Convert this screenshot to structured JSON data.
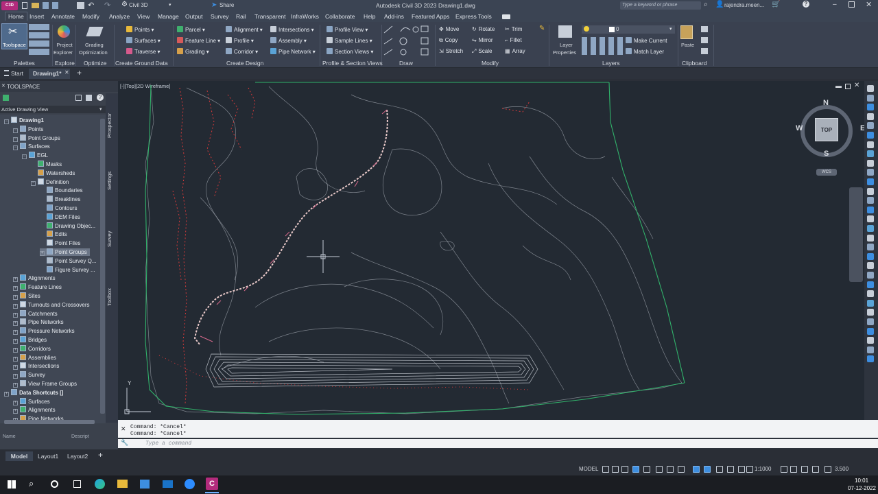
{
  "quick_access": {
    "app_badge": "C3D",
    "workspace": "Civil 3D",
    "share_label": "Share",
    "title": "Autodesk Civil 3D 2023",
    "document": "Drawing1.dwg",
    "search_placeholder": "Type a keyword or phrase",
    "user": "rajendra.meen..."
  },
  "ribbon_tabs": [
    "Home",
    "Insert",
    "Annotate",
    "Modify",
    "Analyze",
    "View",
    "Manage",
    "Output",
    "Survey",
    "Rail",
    "Transparent",
    "InfraWorks",
    "Collaborate",
    "Help",
    "Add-ins",
    "Featured Apps",
    "Express Tools"
  ],
  "ribbon": {
    "toolspace": "Toolspace",
    "project_explorer": [
      "Project",
      "Explorer"
    ],
    "grading_optimization": [
      "Grading",
      "Optimization"
    ],
    "ground": [
      "Points",
      "Surfaces",
      "Traverse"
    ],
    "ground2": [
      "Parcel",
      "Feature Line",
      "Grading"
    ],
    "design": [
      "Alignment",
      "Profile",
      "Corridor"
    ],
    "design2": [
      "Intersections",
      "Assembly",
      "Pipe Network"
    ],
    "profile": [
      "Profile View",
      "Sample Lines",
      "Section Views"
    ],
    "modify": [
      "Move",
      "Copy",
      "Stretch"
    ],
    "modify2": [
      "Rotate",
      "Mirror",
      "Scale"
    ],
    "modify3": [
      "Trim",
      "Fillet",
      "Array"
    ],
    "layer_props": [
      "Layer",
      "Properties"
    ],
    "layer_value": "0",
    "make_current": "Make Current",
    "match_layer": "Match Layer",
    "paste": "Paste",
    "groups": {
      "palettes": "Palettes",
      "explore": "Explore",
      "optimize": "Optimize",
      "create_ground": "Create Ground Data",
      "create_design": "Create Design",
      "profile_section": "Profile & Section Views",
      "draw": "Draw",
      "modify": "Modify",
      "layers": "Layers",
      "clipboard": "Clipboard"
    }
  },
  "doc_tabs": {
    "start": "Start",
    "drawing": "Drawing1*"
  },
  "toolspace": {
    "title": "TOOLSPACE",
    "view_selector": "Active Drawing View",
    "side_tabs": [
      "Prospector",
      "Settings",
      "Survey",
      "Toolbox"
    ],
    "items": [
      {
        "label": "Drawing1",
        "level": 0
      },
      {
        "label": "Points",
        "level": 1
      },
      {
        "label": "Point Groups",
        "level": 1
      },
      {
        "label": "Surfaces",
        "level": 1
      },
      {
        "label": "EGL",
        "level": 2
      },
      {
        "label": "Masks",
        "level": 3
      },
      {
        "label": "Watersheds",
        "level": 3
      },
      {
        "label": "Definition",
        "level": 3
      },
      {
        "label": "Boundaries",
        "level": 4
      },
      {
        "label": "Breaklines",
        "level": 4
      },
      {
        "label": "Contours",
        "level": 4
      },
      {
        "label": "DEM Files",
        "level": 4
      },
      {
        "label": "Drawing Objec...",
        "level": 4
      },
      {
        "label": "Edits",
        "level": 4
      },
      {
        "label": "Point Files",
        "level": 4
      },
      {
        "label": "Point Groups",
        "level": 4
      },
      {
        "label": "Point Survey Q...",
        "level": 4
      },
      {
        "label": "Figure Survey ...",
        "level": 4
      },
      {
        "label": "Alignments",
        "level": 1
      },
      {
        "label": "Feature Lines",
        "level": 1
      },
      {
        "label": "Sites",
        "level": 1
      },
      {
        "label": "Turnouts and Crossovers",
        "level": 1
      },
      {
        "label": "Catchments",
        "level": 1
      },
      {
        "label": "Pipe Networks",
        "level": 1
      },
      {
        "label": "Pressure Networks",
        "level": 1
      },
      {
        "label": "Bridges",
        "level": 1
      },
      {
        "label": "Corridors",
        "level": 1
      },
      {
        "label": "Assemblies",
        "level": 1
      },
      {
        "label": "Intersections",
        "level": 1
      },
      {
        "label": "Survey",
        "level": 1
      },
      {
        "label": "View Frame Groups",
        "level": 1
      },
      {
        "label": "Data Shortcuts []",
        "level": 0
      },
      {
        "label": "Surfaces",
        "level": 1
      },
      {
        "label": "Alignments",
        "level": 1
      },
      {
        "label": "Pipe Networks",
        "level": 1
      }
    ],
    "bottom_cols": [
      "Name",
      "Descript"
    ]
  },
  "viewport": {
    "label": "[-][Top][2D Wireframe]",
    "viewcube": {
      "top": "TOP",
      "n": "N",
      "s": "S",
      "e": "E",
      "w": "W",
      "wcs": "WCS"
    },
    "ucs_y": "Y"
  },
  "command": {
    "history": [
      "Command: *Cancel*",
      "Command: *Cancel*"
    ],
    "placeholder": "Type a command"
  },
  "layout_tabs": [
    "Model",
    "Layout1",
    "Layout2"
  ],
  "status": {
    "model": "MODEL",
    "scale": "1:1000",
    "value": "3.500"
  },
  "clock": {
    "time": "10:01",
    "date": "07-12-2022"
  },
  "colors": {
    "accent": "#3d8ee0",
    "contour": "#9aa0a8",
    "red": "#d63a3a",
    "boundary": "#31b36b",
    "alignment": "#e9c9c9"
  }
}
